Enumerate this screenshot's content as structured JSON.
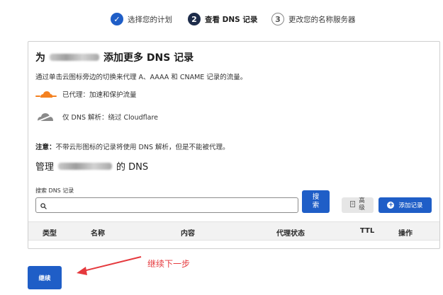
{
  "stepper": {
    "steps": [
      {
        "label": "选择您的计划",
        "status": "done",
        "marker": "✓"
      },
      {
        "label": "查看 DNS 记录",
        "status": "active",
        "marker": "2"
      },
      {
        "label": "更改您的名称服务器",
        "status": "todo",
        "marker": "3"
      }
    ]
  },
  "card": {
    "title_prefix": "为",
    "title_suffix": "添加更多 DNS 记录",
    "intro": "通过单击云图标旁边的切换来代理 A、AAAA 和 CNAME 记录的流量。",
    "legend": [
      {
        "icon": "orange-cloud-icon",
        "text": "已代理：加速和保护流量",
        "color": "#f48120"
      },
      {
        "icon": "grey-cloud-icon",
        "text": "仅 DNS 解析：绕过 Cloudflare",
        "color": "#8a8a8a"
      }
    ],
    "note_bold": "注意：",
    "note_text": "不带云形图标的记录将使用 DNS 解析，但是不能被代理。",
    "manage_prefix": "管理",
    "manage_suffix": "的 DNS",
    "search": {
      "label": "搜索 DNS 记录",
      "value": "",
      "placeholder": ""
    },
    "buttons": {
      "search_line1": "搜",
      "search_line2": "索",
      "advanced_line1": "高",
      "advanced_line2": "级",
      "add_record": "添加记录"
    },
    "table_headers": [
      "类型",
      "名称",
      "内容",
      "代理状态",
      "TTL",
      "操作"
    ]
  },
  "continue_label": "继续",
  "annotation": {
    "text": "继续下一步",
    "color": "#e5393d"
  },
  "colors": {
    "primary": "#1f5ec7",
    "active_step": "#1d2c4a",
    "orange_cloud": "#f48120"
  }
}
